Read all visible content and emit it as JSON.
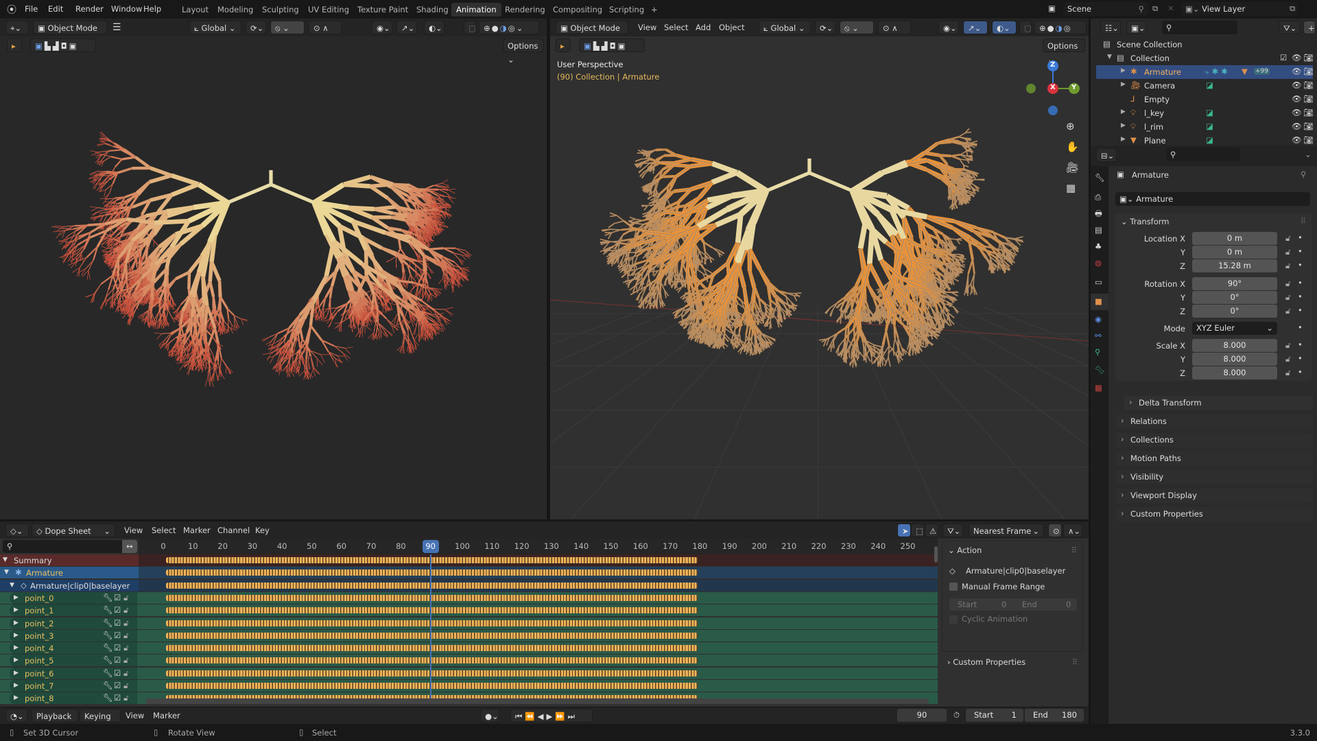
{
  "topbar": {
    "menus": [
      "File",
      "Edit",
      "Render",
      "Window",
      "Help"
    ],
    "workspaces": [
      "Layout",
      "Modeling",
      "Sculpting",
      "UV Editing",
      "Texture Paint",
      "Shading",
      "Animation",
      "Rendering",
      "Compositing",
      "Scripting"
    ],
    "active_workspace": "Animation",
    "add_tab": "+",
    "scene": "Scene",
    "view_layer": "View Layer"
  },
  "left_viewport": {
    "mode": "Object Mode",
    "orientation": "Global",
    "options": "Options"
  },
  "right_viewport": {
    "mode": "Object Mode",
    "menus": [
      "View",
      "Select",
      "Add",
      "Object"
    ],
    "orientation": "Global",
    "options": "Options",
    "view_name": "User Perspective",
    "context": "(90) Collection | Armature",
    "gizmo": {
      "z": "Z",
      "x": "X",
      "y": "Y"
    }
  },
  "outliner": {
    "items": [
      {
        "name": "Scene Collection"
      },
      {
        "name": "Collection"
      },
      {
        "name": "Armature",
        "badge": "+99"
      },
      {
        "name": "Camera"
      },
      {
        "name": "Empty"
      },
      {
        "name": "l_key"
      },
      {
        "name": "l_rim"
      },
      {
        "name": "Plane"
      }
    ]
  },
  "properties": {
    "object_name": "Armature",
    "data_name": "Armature",
    "transform": {
      "title": "Transform",
      "location_label": "Location X",
      "rotation_label": "Rotation X",
      "y": "Y",
      "z": "Z",
      "location": [
        "0 m",
        "0 m",
        "15.28 m"
      ],
      "rotation": [
        "90°",
        "0°",
        "0°"
      ],
      "mode_label": "Mode",
      "mode": "XYZ Euler",
      "scale_label": "Scale X",
      "scale": [
        "8.000",
        "8.000",
        "8.000"
      ]
    },
    "sections": [
      "Delta Transform",
      "Relations",
      "Collections",
      "Motion Paths",
      "Visibility",
      "Viewport Display",
      "Custom Properties"
    ]
  },
  "dopesheet": {
    "mode": "Dope Sheet",
    "menus": [
      "View",
      "Select",
      "Marker",
      "Channel",
      "Key"
    ],
    "snap": "Nearest Frame",
    "current_frame": 90,
    "ticks": [
      0,
      10,
      20,
      30,
      40,
      50,
      60,
      70,
      80,
      90,
      100,
      110,
      120,
      130,
      140,
      150,
      160,
      170,
      180,
      190,
      200,
      210,
      220,
      230,
      240,
      250
    ],
    "keyframe_range": [
      1,
      180
    ],
    "channels": [
      {
        "name": "Summary",
        "type": "summary"
      },
      {
        "name": "Armature",
        "type": "object"
      },
      {
        "name": "Armature|clip0|baselayer",
        "type": "action"
      },
      {
        "name": "point_0",
        "type": "group"
      },
      {
        "name": "point_1",
        "type": "group"
      },
      {
        "name": "point_2",
        "type": "group"
      },
      {
        "name": "point_3",
        "type": "group"
      },
      {
        "name": "point_4",
        "type": "group"
      },
      {
        "name": "point_5",
        "type": "group"
      },
      {
        "name": "point_6",
        "type": "group"
      },
      {
        "name": "point_7",
        "type": "group"
      },
      {
        "name": "point_8",
        "type": "group"
      }
    ],
    "action_panel": {
      "title": "Action",
      "action_name": "Armature|clip0|baselayer",
      "manual_range": "Manual Frame Range",
      "start_label": "Start",
      "start": "0",
      "end_label": "End",
      "end": "0",
      "cyclic": "Cyclic Animation",
      "custom_props": "Custom Properties"
    }
  },
  "timeline": {
    "menus": [
      "Playback",
      "Keying",
      "View",
      "Marker"
    ],
    "current_frame": "90",
    "start_label": "Start",
    "start": "1",
    "end_label": "End",
    "end": "180"
  },
  "statusbar": {
    "hints": [
      "Set 3D Cursor",
      "Rotate View",
      "Select"
    ],
    "version": "3.3.0"
  },
  "colors": {
    "accent": "#4772b3",
    "selection": "#334d80",
    "key": "#f0b45a",
    "context_text": "#e5b95c",
    "channel_group": "#1f4a3c"
  }
}
